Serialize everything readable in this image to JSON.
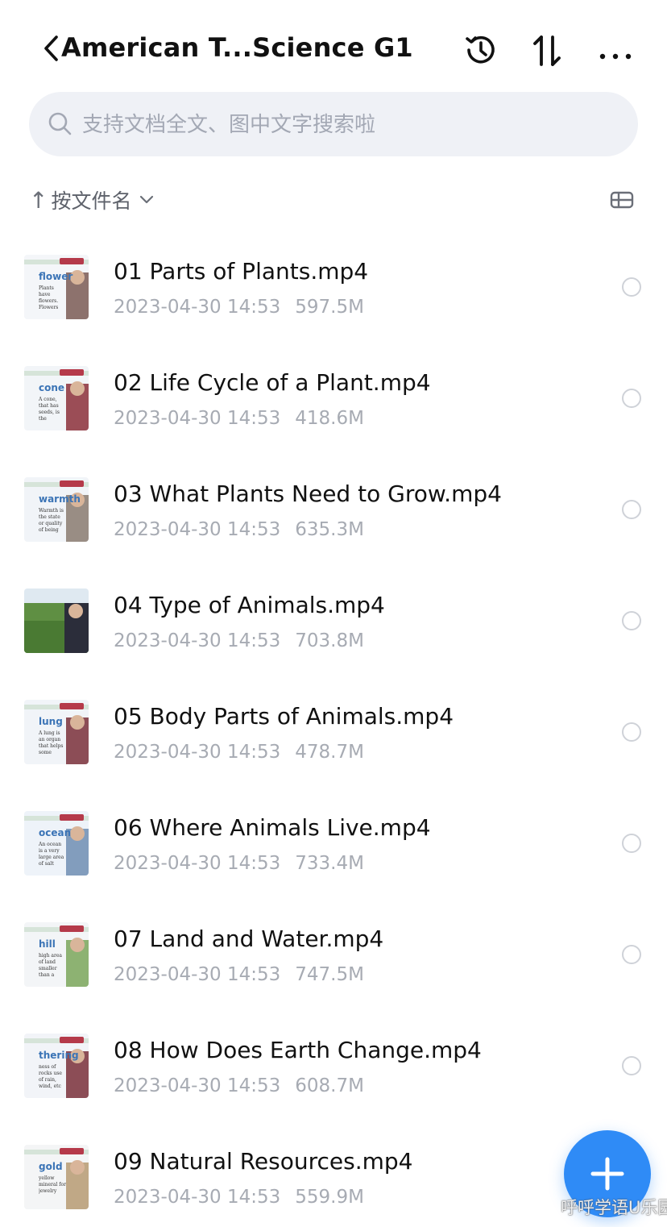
{
  "header": {
    "title": "American T...Science G1",
    "back_icon": "chevron-left-icon",
    "history_icon": "history-icon",
    "sort_icon": "sort-icon",
    "more_icon": "more-horizontal-icon"
  },
  "search": {
    "placeholder": "支持文档全文、图中文字搜索啦",
    "value": ""
  },
  "sortbar": {
    "arrow": "↑",
    "label": "按文件名",
    "view_icon": "grid-list-icon"
  },
  "files": [
    {
      "name": "01 Parts of Plants.mp4",
      "date": "2023-04-30 14:53",
      "size": "597.5M",
      "thumb_word": "flower",
      "thumb_text": "Plants have flowers. Flowers make fruit."
    },
    {
      "name": "02 Life Cycle of a Plant.mp4",
      "date": "2023-04-30 14:53",
      "size": "418.6M",
      "thumb_word": "cone",
      "thumb_text": "A cone, that has seeds, is the"
    },
    {
      "name": "03 What Plants Need to Grow.mp4",
      "date": "2023-04-30 14:53",
      "size": "635.3M",
      "thumb_word": "warmth",
      "thumb_text": "Warmth is the state or quality of being warm."
    },
    {
      "name": "04 Type of Animals.mp4",
      "date": "2023-04-30 14:53",
      "size": "703.8M",
      "thumb_word": "",
      "thumb_text": ""
    },
    {
      "name": "05 Body Parts of Animals.mp4",
      "date": "2023-04-30 14:53",
      "size": "478.7M",
      "thumb_word": "lung",
      "thumb_text": "A lung is an organ that helps some animals breathe."
    },
    {
      "name": "06 Where Animals Live.mp4",
      "date": "2023-04-30 14:53",
      "size": "733.4M",
      "thumb_word": "ocean",
      "thumb_text": "An ocean is a very large area of salt water."
    },
    {
      "name": "07 Land and Water.mp4",
      "date": "2023-04-30 14:53",
      "size": "747.5M",
      "thumb_word": "hill",
      "thumb_text": "high area of land smaller than a mountain"
    },
    {
      "name": "08 How Does Earth Change.mp4",
      "date": "2023-04-30 14:53",
      "size": "608.7M",
      "thumb_word": "thering",
      "thumb_text": "ness of rocks use of rain, wind, etc"
    },
    {
      "name": "09 Natural Resources.mp4",
      "date": "2023-04-30 14:53",
      "size": "559.9M",
      "thumb_word": "gold",
      "thumb_text": "yellow mineral for jewelry"
    }
  ],
  "fab": {
    "icon": "plus-icon"
  },
  "watermark": "呼呼学语U乐园",
  "colors": {
    "accent": "#2f8bf6",
    "search_bg": "#eff1f6",
    "meta_text": "#a7abb3"
  }
}
